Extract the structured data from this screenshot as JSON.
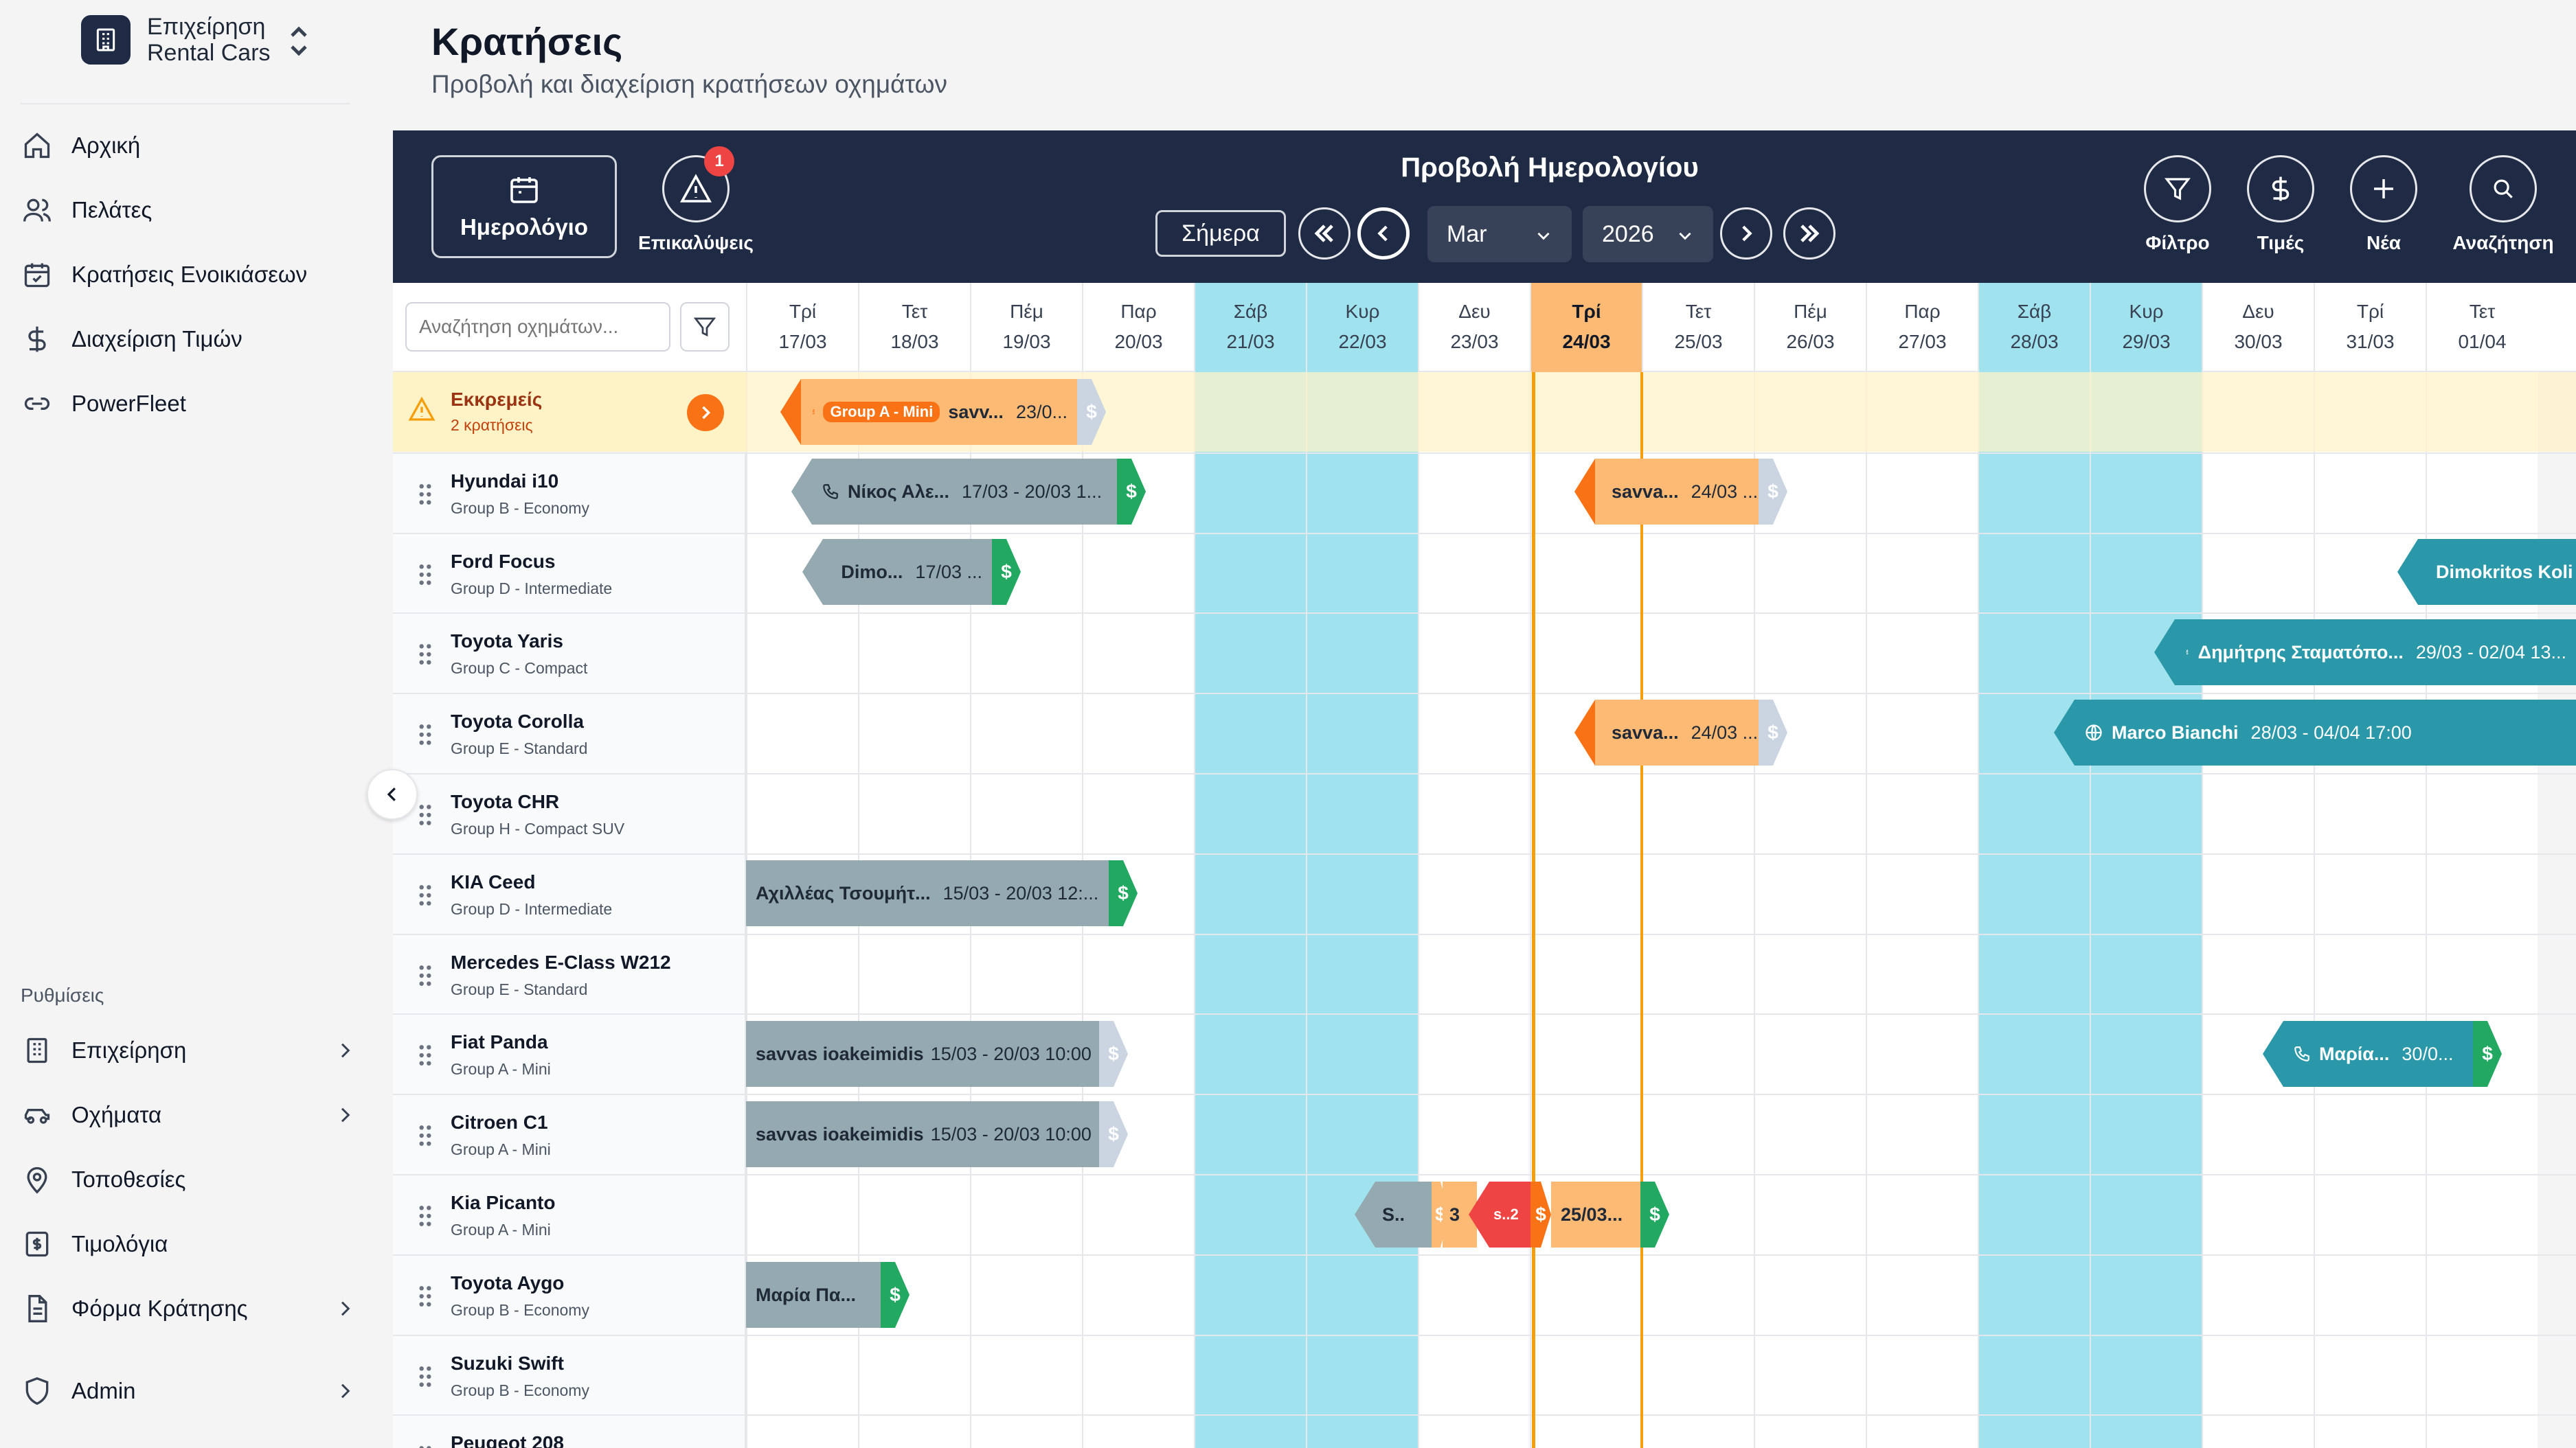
{
  "brand": {
    "line1": "Επιχείρηση",
    "line2": "Rental Cars"
  },
  "nav": [
    {
      "label": "Αρχική",
      "icon": "home-icon"
    },
    {
      "label": "Πελάτες",
      "icon": "users-icon"
    },
    {
      "label": "Κρατήσεις Ενοικιάσεων",
      "icon": "calendar-check-icon"
    },
    {
      "label": "Διαχείριση Τιμών",
      "icon": "dollar-icon"
    },
    {
      "label": "PowerFleet",
      "icon": "link-icon"
    }
  ],
  "settings_label": "Ρυθμίσεις",
  "settings_nav": [
    {
      "label": "Επιχείρηση",
      "icon": "building-icon"
    },
    {
      "label": "Οχήματα",
      "icon": "car-icon"
    },
    {
      "label": "Τοποθεσίες",
      "icon": "map-pin-icon"
    },
    {
      "label": "Τιμολόγια",
      "icon": "invoice-icon"
    },
    {
      "label": "Φόρμα Κράτησης",
      "icon": "document-icon"
    },
    {
      "label": "Admin",
      "icon": "shield-icon"
    }
  ],
  "page": {
    "title": "Κρατήσεις",
    "subtitle": "Προβολή και διαχείριση κρατήσεων οχημάτων"
  },
  "toolbar": {
    "calendar_label": "Ημερολόγιο",
    "conflicts_label": "Επικαλύψεις",
    "conflicts_count": "1",
    "view_title": "Προβολή Ημερολογίου",
    "today_label": "Σήμερα",
    "month_value": "Mar",
    "year_value": "2026",
    "filter_label": "Φίλτρο",
    "prices_label": "Τιμές",
    "new_label": "Νέα",
    "search_label": "Αναζήτηση"
  },
  "grid": {
    "search_placeholder": "Αναζήτηση οχημάτων...",
    "days": [
      {
        "name": "Τρί",
        "date": "17/03",
        "weekend": false
      },
      {
        "name": "Τετ",
        "date": "18/03",
        "weekend": false
      },
      {
        "name": "Πέμ",
        "date": "19/03",
        "weekend": false
      },
      {
        "name": "Παρ",
        "date": "20/03",
        "weekend": false
      },
      {
        "name": "Σάβ",
        "date": "21/03",
        "weekend": true
      },
      {
        "name": "Κυρ",
        "date": "22/03",
        "weekend": true
      },
      {
        "name": "Δευ",
        "date": "23/03",
        "weekend": false
      },
      {
        "name": "Τρί",
        "date": "24/03",
        "weekend": false,
        "today": true
      },
      {
        "name": "Τετ",
        "date": "25/03",
        "weekend": false
      },
      {
        "name": "Πέμ",
        "date": "26/03",
        "weekend": false
      },
      {
        "name": "Παρ",
        "date": "27/03",
        "weekend": false
      },
      {
        "name": "Σάβ",
        "date": "28/03",
        "weekend": true
      },
      {
        "name": "Κυρ",
        "date": "29/03",
        "weekend": true
      },
      {
        "name": "Δευ",
        "date": "30/03",
        "weekend": false
      },
      {
        "name": "Τρί",
        "date": "31/03",
        "weekend": false
      },
      {
        "name": "Τετ",
        "date": "01/04",
        "weekend": false
      }
    ],
    "pending": {
      "title": "Εκκρεμείς",
      "subtitle": "2 κρατήσεις"
    },
    "vehicles": [
      {
        "name": "Hyundai i10",
        "group": "Group B - Economy"
      },
      {
        "name": "Ford Focus",
        "group": "Group D - Intermediate"
      },
      {
        "name": "Toyota Yaris",
        "group": "Group C - Compact"
      },
      {
        "name": "Toyota Corolla",
        "group": "Group E - Standard"
      },
      {
        "name": "Toyota CHR",
        "group": "Group H - Compact SUV"
      },
      {
        "name": "KIA Ceed",
        "group": "Group D - Intermediate"
      },
      {
        "name": "Mercedes E-Class W212",
        "group": "Group E - Standard"
      },
      {
        "name": "Fiat Panda",
        "group": "Group A - Mini"
      },
      {
        "name": "Citroen C1",
        "group": "Group A - Mini"
      },
      {
        "name": "Kia Picanto",
        "group": "Group A - Mini"
      },
      {
        "name": "Toyota Aygo",
        "group": "Group B - Economy"
      },
      {
        "name": "Suzuki Swift",
        "group": "Group B - Economy"
      },
      {
        "name": "Peugeot 208",
        "group": ""
      }
    ]
  },
  "bookings": {
    "pending_1": {
      "pill": "Group A - Mini",
      "name": "savv...",
      "dates": "23/0...",
      "tail": "$"
    },
    "hyundai_1": {
      "name": "Νίκος Αλε...",
      "dates": "17/03 - 20/03 1...",
      "tail": "$"
    },
    "hyundai_2": {
      "name": "savva...",
      "dates": "24/03 ...",
      "tail": "$"
    },
    "ford_1": {
      "name": "Dimo...",
      "dates": "17/03 ...",
      "tail": "$"
    },
    "ford_2": {
      "name": "Dimokritos Koli",
      "dates": ""
    },
    "yaris_1": {
      "name": "Δημήτρης Σταματόπο...",
      "dates": "29/03 - 02/04 13..."
    },
    "corolla_1": {
      "name": "savva...",
      "dates": "24/03 ...",
      "tail": "$"
    },
    "corolla_2": {
      "name": "Marco Bianchi",
      "dates": "28/03 - 04/04 17:00"
    },
    "ceed_1": {
      "name": "Αχιλλέας Τσουμήτ...",
      "dates": "15/03 - 20/03 12:...",
      "tail": "$"
    },
    "panda_1": {
      "name": "savvas ioakeimidis",
      "dates": "15/03 - 20/03 10:00",
      "tail": "$"
    },
    "panda_2": {
      "name": "Μαρία...",
      "dates": "30/0...",
      "tail": "$"
    },
    "c1_1": {
      "name": "savvas ioakeimidis",
      "dates": "15/03 - 20/03 10:00",
      "tail": "$"
    },
    "picanto_1": {
      "name": "S..",
      "tail": "$"
    },
    "picanto_2": {
      "name": "3",
      "dates": ""
    },
    "picanto_3": {
      "name": "s..2",
      "tail": "$"
    },
    "picanto_4": {
      "name": "25/03...",
      "tail": "$"
    },
    "aygo_1": {
      "name": "Μαρία Πα...",
      "tail": "$"
    }
  },
  "colors": {
    "toolbar_bg": "#1f2a44",
    "weekend_bg": "#a0e3ee",
    "today_bg": "#fdba74",
    "bar_gray": "#94a9b0",
    "bar_orange": "#fdba74",
    "bar_teal": "#2a98a8",
    "accent_orange": "#f97316",
    "money_green": "#22a861",
    "conflict_red": "#ef4444"
  }
}
